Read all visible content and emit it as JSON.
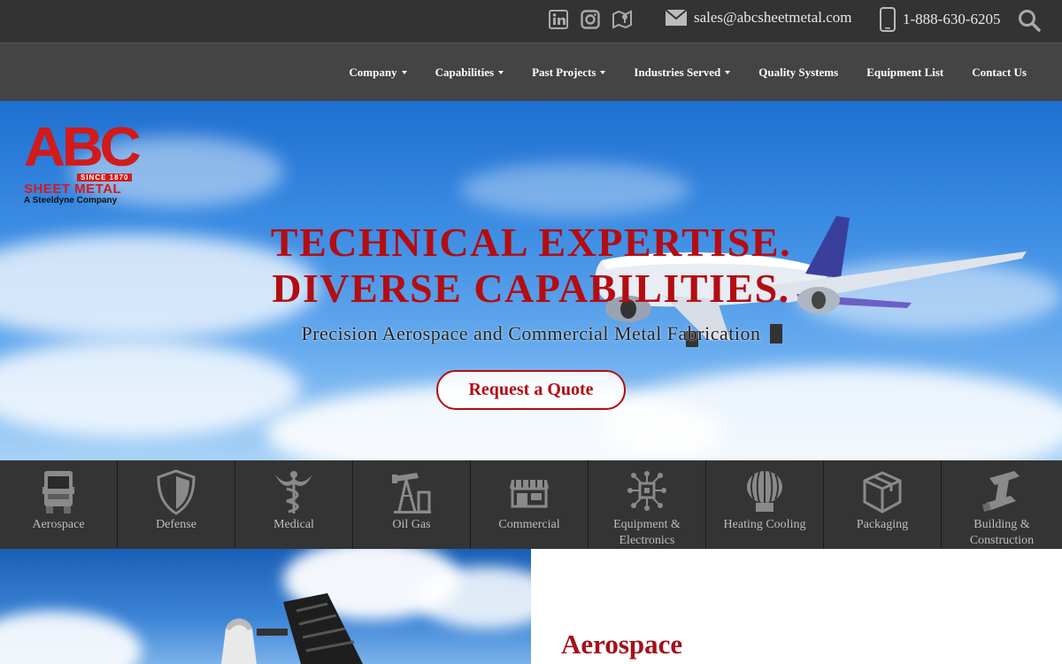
{
  "topbar": {
    "social_icons": [
      "linkedin-icon",
      "instagram-icon",
      "map-icon"
    ],
    "email": "sales@abcsheetmetal.com",
    "phone": "1-888-630-6205"
  },
  "nav": {
    "items": [
      {
        "label": "Company",
        "dropdown": true
      },
      {
        "label": "Capabilities",
        "dropdown": true
      },
      {
        "label": "Past Projects",
        "dropdown": true
      },
      {
        "label": "Industries Served",
        "dropdown": true
      },
      {
        "label": "Quality Systems",
        "dropdown": false
      },
      {
        "label": "Equipment List",
        "dropdown": false
      },
      {
        "label": "Contact Us",
        "dropdown": false
      }
    ]
  },
  "logo": {
    "brand": "ABC",
    "since": "SINCE 1870",
    "name": "SHEET METAL",
    "tagline": "A Steeldyne Company"
  },
  "hero": {
    "headline_1": "TECHNICAL EXPERTISE.",
    "headline_2": "DIVERSE CAPABILITIES.",
    "subheadline": "Precision Aerospace and Commercial Metal Fabrication",
    "cta": "Request a Quote"
  },
  "industries": [
    {
      "label": "Aerospace",
      "icon": "truck-icon"
    },
    {
      "label": "Defense",
      "icon": "shield-icon"
    },
    {
      "label": "Medical",
      "icon": "caduceus-icon"
    },
    {
      "label": "Oil Gas",
      "icon": "oil-pump-icon"
    },
    {
      "label": "Commercial",
      "icon": "storefront-icon"
    },
    {
      "label": "Equipment & Electronics",
      "icon": "chip-icon"
    },
    {
      "label": "Heating Cooling",
      "icon": "vent-icon"
    },
    {
      "label": "Packaging",
      "icon": "box-icon"
    },
    {
      "label": "Building & Construction",
      "icon": "steel-beam-icon"
    }
  ],
  "section": {
    "title": "Aerospace"
  },
  "colors": {
    "brand_red": "#b30d12",
    "topbar": "#333333",
    "nav": "#444444",
    "tiles": "#343434"
  }
}
